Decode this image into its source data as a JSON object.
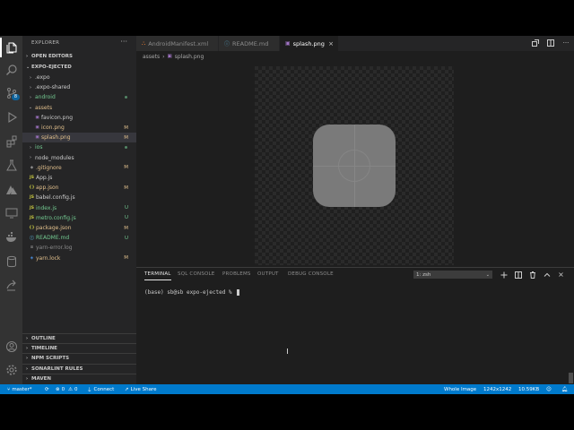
{
  "sidebar": {
    "title": "EXPLORER",
    "more": "···",
    "open_editors": "OPEN EDITORS",
    "project": "EXPO-EJECTED",
    "tree": [
      {
        "label": ".expo",
        "kind": "folder",
        "expanded": false,
        "color": "#cccccc",
        "status": ""
      },
      {
        "label": ".expo-shared",
        "kind": "folder",
        "expanded": false,
        "color": "#cccccc",
        "status": ""
      },
      {
        "label": "android",
        "kind": "folder",
        "expanded": false,
        "color": "#73c991",
        "status": "dot"
      },
      {
        "label": "assets",
        "kind": "folder",
        "expanded": true,
        "color": "#e2c08d",
        "status": ""
      },
      {
        "label": "favicon.png",
        "kind": "image",
        "indent": 1,
        "color": "#cccccc",
        "status": ""
      },
      {
        "label": "icon.png",
        "kind": "image",
        "indent": 1,
        "color": "#e2c08d",
        "status": "M"
      },
      {
        "label": "splash.png",
        "kind": "image",
        "indent": 1,
        "color": "#e2c08d",
        "status": "M",
        "selected": true
      },
      {
        "label": "ios",
        "kind": "folder",
        "expanded": false,
        "color": "#73c991",
        "status": "dot"
      },
      {
        "label": "node_modules",
        "kind": "folder",
        "expanded": false,
        "color": "#cccccc",
        "status": ""
      },
      {
        "label": ".gitignore",
        "kind": "git",
        "color": "#e2c08d",
        "status": "M"
      },
      {
        "label": "App.js",
        "kind": "js",
        "color": "#cccccc",
        "status": ""
      },
      {
        "label": "app.json",
        "kind": "json",
        "color": "#e2c08d",
        "status": "M"
      },
      {
        "label": "babel.config.js",
        "kind": "js",
        "color": "#cccccc",
        "status": ""
      },
      {
        "label": "index.js",
        "kind": "js",
        "color": "#73c991",
        "status": "U"
      },
      {
        "label": "metro.config.js",
        "kind": "js",
        "color": "#73c991",
        "status": "U"
      },
      {
        "label": "package.json",
        "kind": "json",
        "color": "#e2c08d",
        "status": "M"
      },
      {
        "label": "README.md",
        "kind": "md",
        "color": "#73c991",
        "status": "U"
      },
      {
        "label": "yarn-error.log",
        "kind": "log",
        "color": "#8b8b8b",
        "status": ""
      },
      {
        "label": "yarn.lock",
        "kind": "lock",
        "color": "#e2c08d",
        "status": "M"
      }
    ],
    "sections": [
      "OUTLINE",
      "TIMELINE",
      "NPM SCRIPTS",
      "SONARLINT RULES",
      "MAVEN"
    ]
  },
  "tabs": [
    {
      "label": "AndroidManifest.xml",
      "icon": "xml-icon",
      "active": false
    },
    {
      "label": "README.md",
      "icon": "info-icon",
      "active": false
    },
    {
      "label": "splash.png",
      "icon": "image-icon",
      "active": true
    }
  ],
  "breadcrumb": {
    "folder": "assets",
    "sep": "›",
    "file": "splash.png"
  },
  "panel": {
    "tabs": [
      "TERMINAL",
      "SQL CONSOLE",
      "PROBLEMS",
      "OUTPUT",
      "DEBUG CONSOLE"
    ],
    "active_tab": "TERMINAL",
    "terminal_select": "1: zsh",
    "prompt": "(base) sb@sb expo-ejected % "
  },
  "status": {
    "branch": "master*",
    "errors": "0",
    "warnings": "0",
    "connect": "Connect",
    "live_share": "Live Share",
    "whole_image": "Whole Image",
    "dimensions": "1242x1242",
    "size": "10.59KB"
  },
  "colors": {
    "accent": "#007acc",
    "modified": "#e2c08d",
    "untracked": "#73c991"
  }
}
